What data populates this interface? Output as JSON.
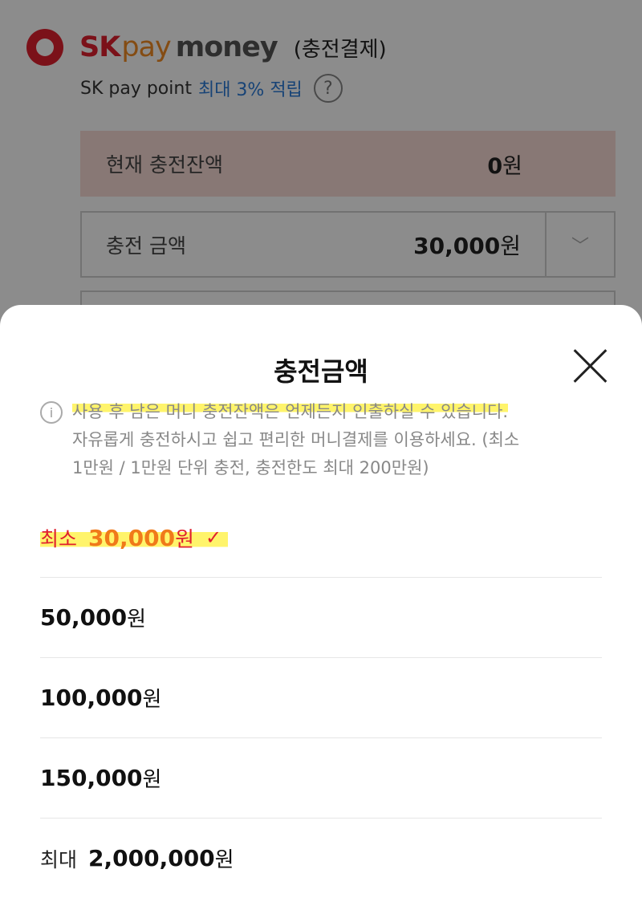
{
  "brand": {
    "sk": "SK",
    "pay": "pay",
    "money": "money",
    "subtitle": "(충전결제)"
  },
  "point": {
    "label": "SK pay point",
    "accent": "최대 3% 적립",
    "help_icon": "?"
  },
  "balance": {
    "label": "현재 충전잔액",
    "value": "0",
    "unit": "원"
  },
  "charge_amount": {
    "label": "충전 금액",
    "value": "30,000",
    "unit": "원",
    "arrow": "﹀"
  },
  "sheet": {
    "title": "충전금액",
    "info_icon": "i",
    "info_line1": "사용 후 남은 머니 충전잔액은 언제든지 인출하실 수 있습니다.",
    "info_line2": "자유롭게 충전하시고 쉽고 편리한 머니결제를 이용하세요. (최소",
    "info_line3": "1만원 / 1만원 단위 충전, 충전한도 최대 200만원)",
    "options": [
      {
        "prefix": "최소",
        "value": "30,000",
        "unit": "원",
        "check": "✓"
      },
      {
        "prefix": "",
        "value": "50,000",
        "unit": "원"
      },
      {
        "prefix": "",
        "value": "100,000",
        "unit": "원"
      },
      {
        "prefix": "",
        "value": "150,000",
        "unit": "원"
      },
      {
        "prefix": "최대",
        "value": "2,000,000",
        "unit": "원"
      }
    ]
  },
  "colors": {
    "brand_red": "#e0202e",
    "brand_orange": "#f08a24",
    "accent_blue": "#2a7bd8",
    "highlight": "#fff46b",
    "balance_bg": "#f7dad5"
  }
}
